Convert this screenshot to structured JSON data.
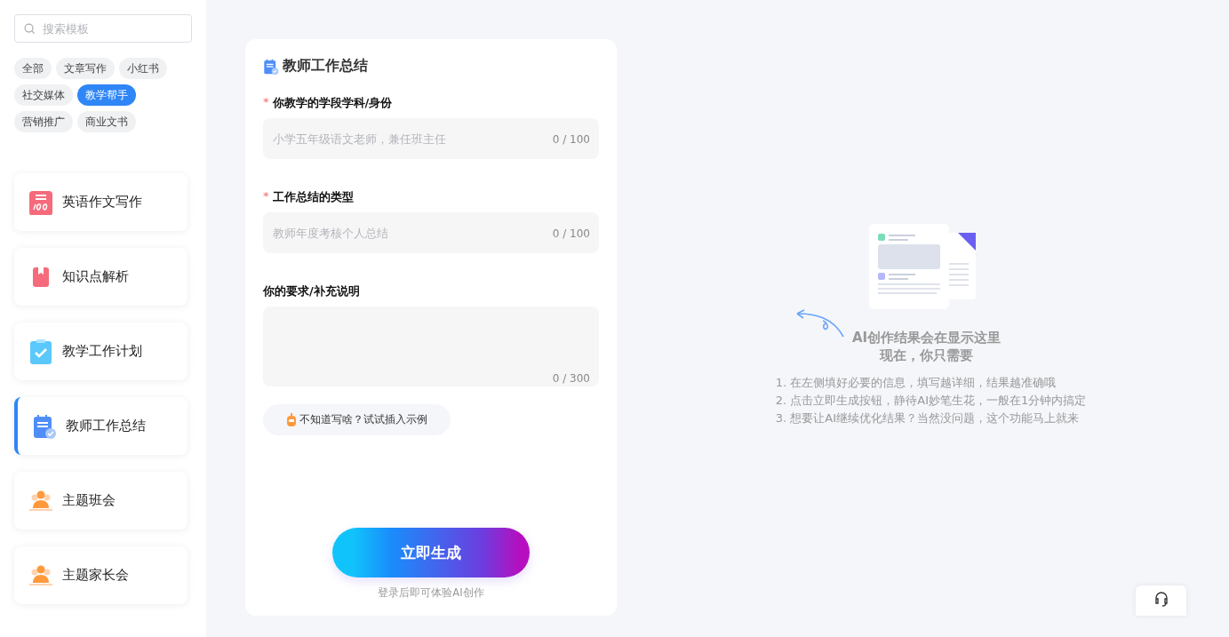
{
  "sidebar": {
    "search": {
      "placeholder": "搜索模板"
    },
    "tags": [
      {
        "label": "全部",
        "selected": false
      },
      {
        "label": "文章写作",
        "selected": false
      },
      {
        "label": "小红书",
        "selected": false
      },
      {
        "label": "社交媒体",
        "selected": false
      },
      {
        "label": "教学帮手",
        "selected": true
      },
      {
        "label": "营销推广",
        "selected": false
      },
      {
        "label": "商业文书",
        "selected": false
      }
    ],
    "templates": [
      {
        "label": "英语作文写作",
        "kind": "score",
        "selected": false
      },
      {
        "label": "知识点解析",
        "kind": "book",
        "selected": false
      },
      {
        "label": "教学工作计划",
        "kind": "clipboard",
        "selected": false
      },
      {
        "label": "教师工作总结",
        "kind": "notes",
        "selected": true
      },
      {
        "label": "主题班会",
        "kind": "people",
        "selected": false
      },
      {
        "label": "主题家长会",
        "kind": "people",
        "selected": false
      }
    ]
  },
  "form": {
    "title": "教师工作总结",
    "fields": [
      {
        "kind": "input",
        "label": "你教学的学段学科/身份",
        "required_mark": "*",
        "placeholder": "小学五年级语文老师，兼任班主任",
        "counter": "0 / 100"
      },
      {
        "kind": "input",
        "label": "工作总结的类型",
        "required_mark": "*",
        "placeholder": "教师年度考核个人总结",
        "counter": "0 / 100"
      },
      {
        "kind": "textarea",
        "label": "你的要求/补充说明",
        "counter": "0 / 300"
      }
    ],
    "example_button": "不知道写啥？试试插入示例",
    "generate_button": "立即生成",
    "login_hint": "登录后即可体验AI创作"
  },
  "result": {
    "title_lines": [
      "AI创作结果会在显示这里",
      "现在，你只需要"
    ],
    "steps": [
      "1. 在左侧填好必要的信息，填写越详细，结果越准确哦",
      "2. 点击立即生成按钮，静待AI妙笔生花，一般在1分钟内搞定",
      "3. 想要让AI继续优化结果？当然没问题，这个功能马上就来"
    ]
  }
}
